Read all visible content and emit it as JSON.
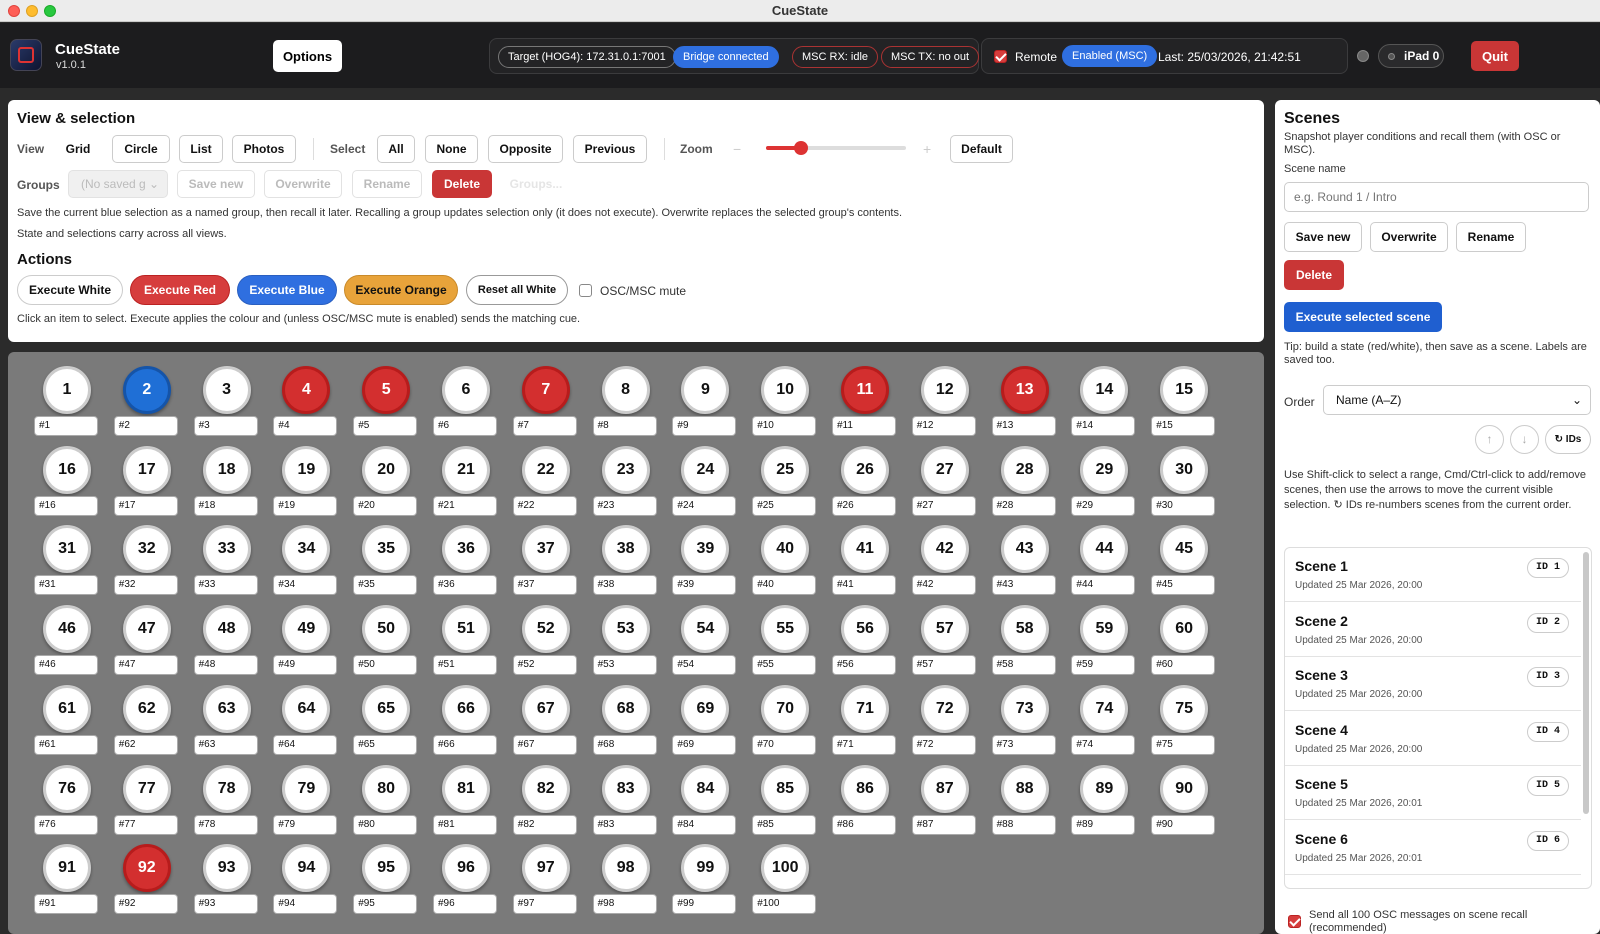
{
  "window": {
    "title": "CueState"
  },
  "header": {
    "app_name": "CueState",
    "version": "v1.0.1",
    "options_label": "Options",
    "target": "Target (HOG4): 172.31.0.1:7001",
    "bridge": "Bridge connected",
    "msc_rx": "MSC RX: idle",
    "msc_tx": "MSC TX: no out",
    "remote_label": "Remote",
    "remote_checked": true,
    "enabled": "Enabled (MSC)",
    "last": "Last: 25/03/2026, 21:42:51",
    "ipad": "iPad 0",
    "quit_label": "Quit"
  },
  "view_selection": {
    "title": "View & selection",
    "view_label": "View",
    "views": [
      "Grid",
      "Circle",
      "List",
      "Photos"
    ],
    "select_label": "Select",
    "selects": [
      "All",
      "None",
      "Opposite",
      "Previous"
    ],
    "zoom_label": "Zoom",
    "zoom_minus": "−",
    "zoom_plus": "+",
    "zoom_default": "Default",
    "zoom_level": 0.25,
    "groups_label": "Groups",
    "groups_placeholder": "(No saved g",
    "save_new": "Save new",
    "overwrite": "Overwrite",
    "rename": "Rename",
    "delete": "Delete",
    "groups_btn": "Groups...",
    "help1": "Save the current blue selection as a named group, then recall it later. Recalling a group updates selection only (it does not execute). Overwrite replaces the selected group's contents.",
    "help2": "State and selections carry across all views."
  },
  "actions": {
    "title": "Actions",
    "exec_white": "Execute White",
    "exec_red": "Execute Red",
    "exec_blue": "Execute Blue",
    "exec_orange": "Execute Orange",
    "reset_white": "Reset all White",
    "mute_label": "OSC/MSC mute",
    "help": "Click an item to select. Execute applies the colour and (unless OSC/MSC mute is enabled) sends the matching cue."
  },
  "grid": {
    "red_items": [
      4,
      5,
      7,
      11,
      13,
      92
    ],
    "blue_items": [
      2
    ],
    "count": 100
  },
  "scenes": {
    "title": "Scenes",
    "subtitle": "Snapshot player conditions and recall them (with OSC or MSC).",
    "name_label": "Scene name",
    "name_placeholder": "e.g. Round 1 / Intro",
    "save_new": "Save new",
    "overwrite": "Overwrite",
    "rename": "Rename",
    "delete": "Delete",
    "execute": "Execute selected scene",
    "tip": "Tip: build a state (red/white), then save as a scene. Labels are saved too.",
    "order_label": "Order",
    "order_value": "Name (A–Z)",
    "ids_label": "↻ IDs",
    "instructions": "Use Shift-click to select a range, Cmd/Ctrl-click to add/remove scenes, then use the arrows to move the current visible selection. ↻ IDs re-numbers scenes from the current order.",
    "items": [
      {
        "name": "Scene 1",
        "updated": "Updated 25 Mar 2026, 20:00",
        "id": "ID 1"
      },
      {
        "name": "Scene 2",
        "updated": "Updated 25 Mar 2026, 20:00",
        "id": "ID 2"
      },
      {
        "name": "Scene 3",
        "updated": "Updated 25 Mar 2026, 20:00",
        "id": "ID 3"
      },
      {
        "name": "Scene 4",
        "updated": "Updated 25 Mar 2026, 20:00",
        "id": "ID 4"
      },
      {
        "name": "Scene 5",
        "updated": "Updated 25 Mar 2026, 20:01",
        "id": "ID 5"
      },
      {
        "name": "Scene 6",
        "updated": "Updated 25 Mar 2026, 20:01",
        "id": "ID 6"
      }
    ],
    "send_all": "Send all 100 OSC messages on scene recall (recommended)",
    "send_all_checked": true
  },
  "colors": {
    "red": "#d32f2f",
    "blue": "#1f6fd6",
    "orange": "#e8a33a",
    "accent": "#2f6fe0"
  }
}
